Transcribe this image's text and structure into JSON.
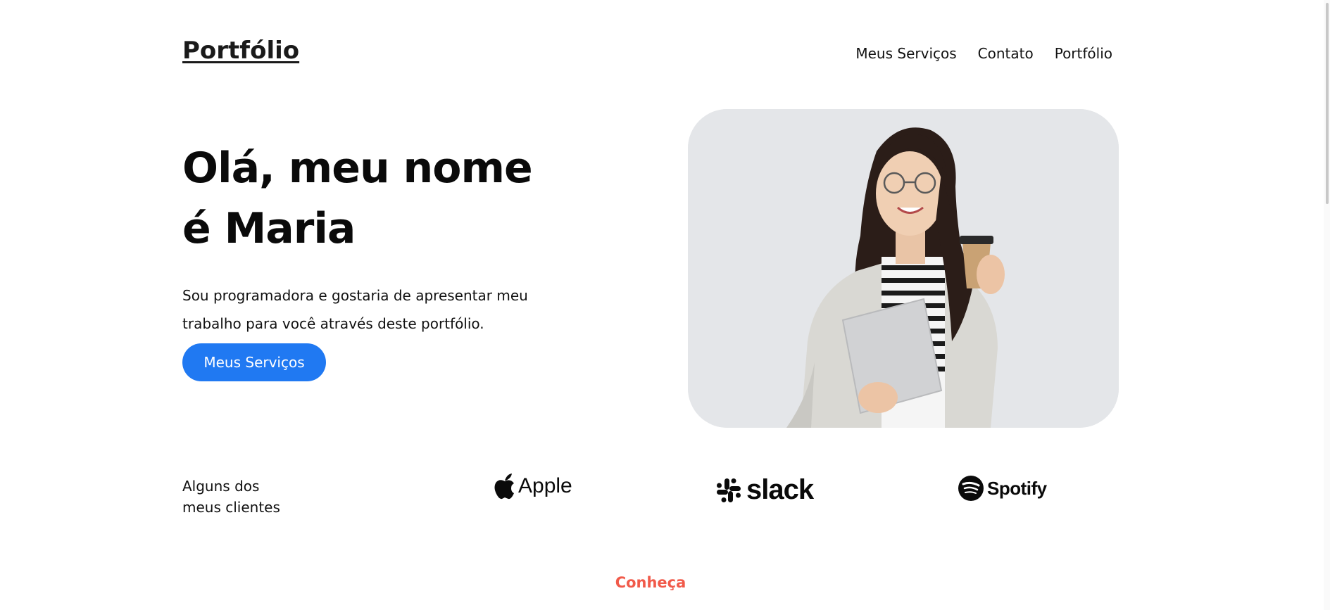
{
  "header": {
    "logo": "Portfólio",
    "nav": [
      "Meus Serviços",
      "Contato",
      "Portfólio"
    ]
  },
  "hero": {
    "title_line1": "Olá, meu nome",
    "title_line2": "é Maria",
    "description_line1": "Sou programadora e gostaria de apresentar meu",
    "description_line2": "trabalho para você através deste portfólio.",
    "cta_label": "Meus Serviços",
    "photo_icon": "portrait-photo"
  },
  "clients": {
    "label_line1": "Alguns dos",
    "label_line2": "meus clientes",
    "logos": [
      {
        "name": "Apple",
        "icon": "apple-logo"
      },
      {
        "name": "slack",
        "icon": "slack-logo"
      },
      {
        "name": "Spotify",
        "icon": "spotify-logo"
      }
    ]
  },
  "next_section": {
    "label": "Conheça"
  },
  "colors": {
    "accent": "#2079f2",
    "highlight": "#f15a4a",
    "photo_background": "#e4e6e9"
  }
}
